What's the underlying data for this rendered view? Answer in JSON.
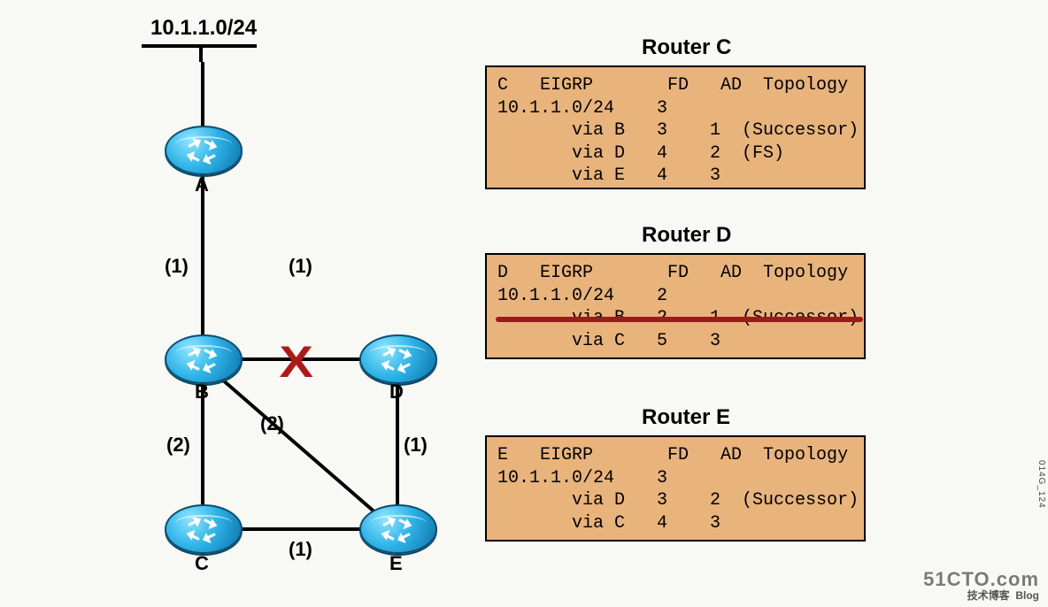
{
  "network": {
    "subnet": "10.1.1.0/24",
    "routers": {
      "A": "A",
      "B": "B",
      "C": "C",
      "D": "D",
      "E": "E"
    },
    "link_costs": {
      "A_B": "(1)",
      "A_area": "(1)",
      "B_C": "(2)",
      "D_C_diag": "(2)",
      "D_E": "(1)",
      "C_E": "(1)"
    },
    "failed_link_mark": "X"
  },
  "tables": {
    "C": {
      "title": "Router C",
      "text": "C   EIGRP       FD   AD  Topology\n10.1.1.0/24    3\n       via B   3    1  (Successor)\n       via D   4    2  (FS)\n       via E   4    3"
    },
    "D": {
      "title": "Router D",
      "text": "D   EIGRP       FD   AD  Topology\n10.1.1.0/24    2\n       via B   2    1  (Successor)\n       via C   5    3",
      "strike_row_index": 2
    },
    "E": {
      "title": "Router E",
      "text": "E   EIGRP       FD   AD  Topology\n10.1.1.0/24    3\n       via D   3    2  (Successor)\n       via C   4    3"
    }
  },
  "watermark": {
    "site": "51CTO.com",
    "tagline_cn": "技术博客",
    "tagline_en": "Blog"
  },
  "side_code": "014G_124",
  "chart_data": {
    "type": "table",
    "topology": {
      "nodes": [
        "A",
        "B",
        "C",
        "D",
        "E"
      ],
      "edges": [
        {
          "u": "Net",
          "v": "A",
          "cost": null
        },
        {
          "u": "A",
          "v": "B",
          "cost": 1
        },
        {
          "u": "B",
          "v": "D",
          "cost": 1,
          "failed": true
        },
        {
          "u": "B",
          "v": "C",
          "cost": 2
        },
        {
          "u": "D",
          "v": "C",
          "cost": 2
        },
        {
          "u": "D",
          "v": "E",
          "cost": 1
        },
        {
          "u": "C",
          "v": "E",
          "cost": 1
        }
      ],
      "destination": "10.1.1.0/24"
    },
    "eigrp_tables": {
      "C": {
        "FD": 3,
        "routes": [
          {
            "via": "B",
            "FD": 3,
            "AD": 1,
            "flag": "Successor"
          },
          {
            "via": "D",
            "FD": 4,
            "AD": 2,
            "flag": "FS"
          },
          {
            "via": "E",
            "FD": 4,
            "AD": 3,
            "flag": null
          }
        ]
      },
      "D": {
        "FD": 2,
        "routes": [
          {
            "via": "B",
            "FD": 2,
            "AD": 1,
            "flag": "Successor",
            "removed": true
          },
          {
            "via": "C",
            "FD": 5,
            "AD": 3,
            "flag": null
          }
        ]
      },
      "E": {
        "FD": 3,
        "routes": [
          {
            "via": "D",
            "FD": 3,
            "AD": 2,
            "flag": "Successor"
          },
          {
            "via": "C",
            "FD": 4,
            "AD": 3,
            "flag": null
          }
        ]
      }
    }
  }
}
